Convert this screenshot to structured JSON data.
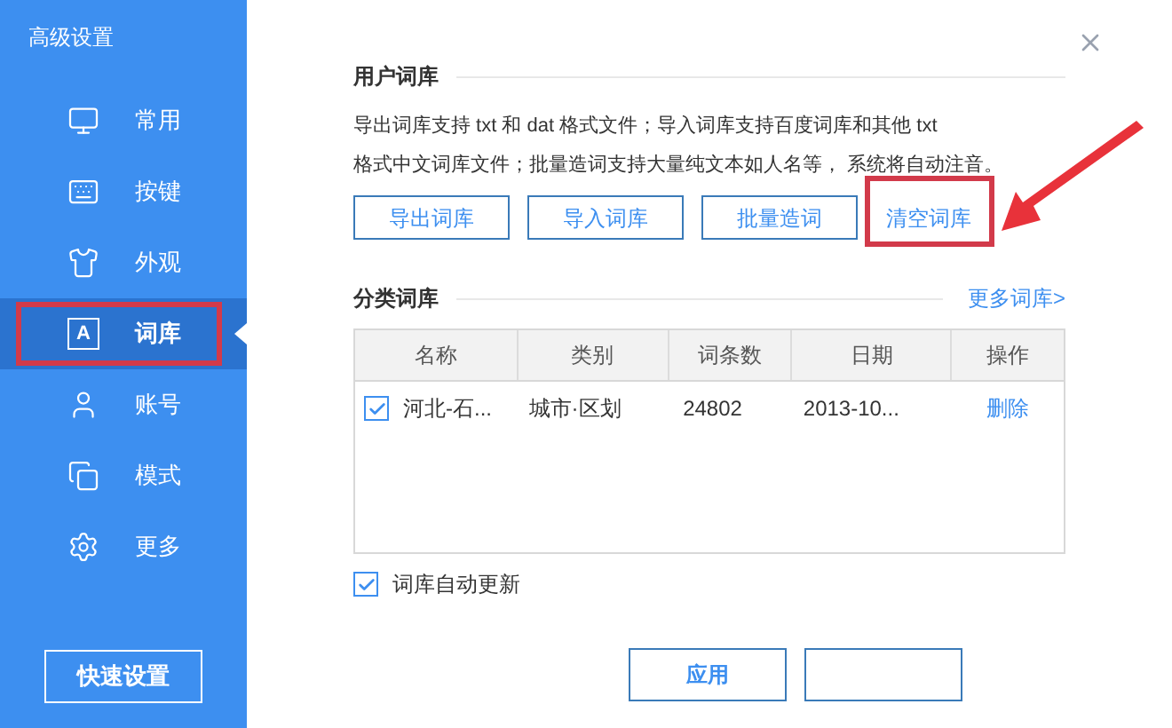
{
  "sidebar": {
    "title": "高级设置",
    "items": [
      {
        "label": "常用",
        "selected": false
      },
      {
        "label": "按键",
        "selected": false
      },
      {
        "label": "外观",
        "selected": false
      },
      {
        "label": "词库",
        "icon_letter": "A",
        "selected": true
      },
      {
        "label": "账号",
        "selected": false
      },
      {
        "label": "模式",
        "selected": false
      },
      {
        "label": "更多",
        "selected": false
      }
    ],
    "button": "快速设置"
  },
  "user_dict": {
    "heading": "用户词库",
    "description": [
      "导出词库支持 txt 和 dat 格式文件；导入词库支持百度词库和其他 txt",
      "格式中文词库文件；批量造词支持大量纯文本如人名等， 系统将自动注音。"
    ],
    "buttons": [
      {
        "label": "导出词库",
        "kind": "button"
      },
      {
        "label": "导入词库",
        "kind": "button"
      },
      {
        "label": "批量造词",
        "kind": "button"
      },
      {
        "label": "清空词库",
        "kind": "link",
        "highlighted": true
      }
    ]
  },
  "category_dict": {
    "heading": "分类词库",
    "more_link": "更多词库>",
    "table": {
      "columns": [
        "名称",
        "类别",
        "词条数",
        "日期",
        "操作"
      ],
      "rows": [
        {
          "checked": true,
          "name": "河北-石...",
          "category": "城市·区划",
          "count": "24802",
          "date": "2013-10...",
          "action": "删除"
        }
      ]
    },
    "auto_update": {
      "label": "词库自动更新",
      "checked": true
    }
  },
  "footer": {
    "buttons": [
      "应用"
    ]
  }
}
